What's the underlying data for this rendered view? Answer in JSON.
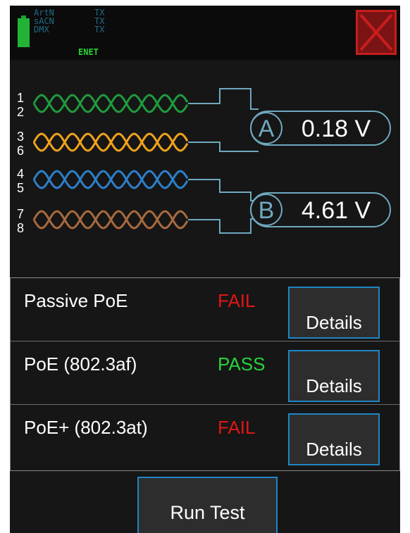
{
  "status_bar": {
    "protocols": [
      {
        "name": "ArtN",
        "state": "TX"
      },
      {
        "name": "sACN",
        "state": "TX"
      },
      {
        "name": "DMX",
        "state": "TX"
      }
    ],
    "network": "ENET",
    "battery_level": 1.0
  },
  "wiring": {
    "pairs": [
      {
        "pins": [
          "1",
          "2"
        ],
        "color": "#1f9b3c"
      },
      {
        "pins": [
          "3",
          "6"
        ],
        "color": "#f0a21a"
      },
      {
        "pins": [
          "4",
          "5"
        ],
        "color": "#2d7fc9"
      },
      {
        "pins": [
          "7",
          "8"
        ],
        "color": "#a86a3e"
      }
    ],
    "connector_color": "#6fa9bf",
    "measurements": [
      {
        "pair": "A",
        "voltage": "0.18 V"
      },
      {
        "pair": "B",
        "voltage": "4.61 V"
      }
    ]
  },
  "results": [
    {
      "name": "Passive PoE",
      "status": "FAIL",
      "status_color": "#e01616",
      "button": "Details"
    },
    {
      "name": "PoE  (802.3af)",
      "status": "PASS",
      "status_color": "#27d33b",
      "button": "Details"
    },
    {
      "name": "PoE+ (802.3at)",
      "status": "FAIL",
      "status_color": "#e01616",
      "button": "Details"
    }
  ],
  "run_button": "Run Test",
  "colors": {
    "accent": "#1f86c4",
    "close": "#c81d1d"
  }
}
